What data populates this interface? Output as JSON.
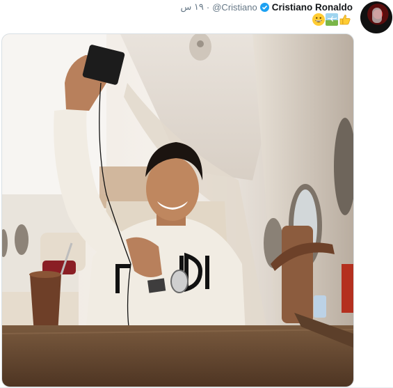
{
  "tweet": {
    "display_name": "Cristiano Ronaldo",
    "handle": "@Cristiano",
    "separator": "·",
    "timestamp": "١٩ س",
    "emojis": [
      "thumbs-up-emoji",
      "airplane-emoji",
      "grinning-face-emoji"
    ],
    "verified": true
  },
  "media": {
    "photo_shirt_text": "FENDI"
  },
  "colors": {
    "name": "#14171a",
    "secondary": "#657786",
    "verified": "#1da1f2"
  }
}
